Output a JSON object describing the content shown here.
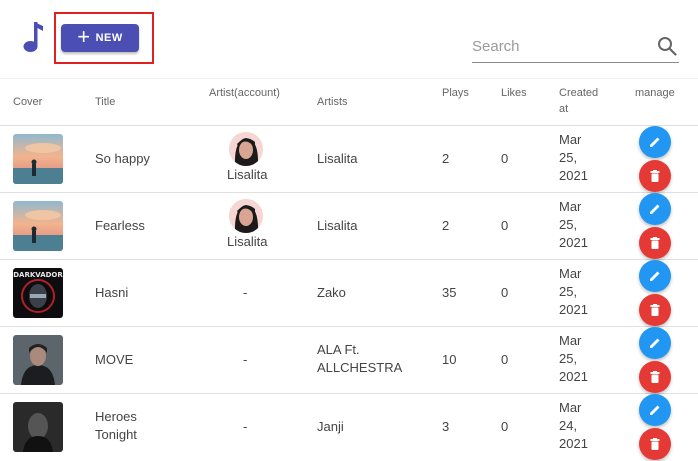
{
  "toolbar": {
    "new_label": "NEW",
    "search_placeholder": "Search"
  },
  "columns": {
    "cover": "Cover",
    "title": "Title",
    "artist_account": "Artist(account)",
    "artists": "Artists",
    "plays": "Plays",
    "likes": "Likes",
    "created_line1": "Created",
    "created_line2": "at",
    "manage": "manage"
  },
  "songs": [
    {
      "title_l1": "So happy",
      "title_l2": "",
      "account": "Lisalita",
      "artists_l1": "Lisalita",
      "artists_l2": "",
      "plays": "2",
      "likes": "0",
      "date_l1": "Mar",
      "date_l2": "25,",
      "date_l3": "2021"
    },
    {
      "title_l1": "Fearless",
      "title_l2": "",
      "account": "Lisalita",
      "artists_l1": "Lisalita",
      "artists_l2": "",
      "plays": "2",
      "likes": "0",
      "date_l1": "Mar",
      "date_l2": "25,",
      "date_l3": "2021"
    },
    {
      "title_l1": "Hasni",
      "title_l2": "",
      "account": "-",
      "artists_l1": "Zako",
      "artists_l2": "",
      "plays": "35",
      "likes": "0",
      "date_l1": "Mar",
      "date_l2": "25,",
      "date_l3": "2021"
    },
    {
      "title_l1": "MOVE",
      "title_l2": "",
      "account": "-",
      "artists_l1": "ALA Ft.",
      "artists_l2": "ALLCHESTRA",
      "plays": "10",
      "likes": "0",
      "date_l1": "Mar",
      "date_l2": "25,",
      "date_l3": "2021"
    },
    {
      "title_l1": "Heroes",
      "title_l2": "Tonight",
      "account": "-",
      "artists_l1": "Janji",
      "artists_l2": "",
      "plays": "3",
      "likes": "0",
      "date_l1": "Mar",
      "date_l2": "24,",
      "date_l3": "2021"
    }
  ],
  "cover_art_text": "DARKVADOR",
  "icons": {
    "logo": "music-note-icon",
    "add": "plus-icon",
    "search": "search-icon",
    "edit": "pencil-icon",
    "delete": "trash-icon"
  },
  "colors": {
    "primary": "#4b4fb3",
    "edit": "#2196f3",
    "delete": "#e53935",
    "highlight": "#e02020"
  }
}
